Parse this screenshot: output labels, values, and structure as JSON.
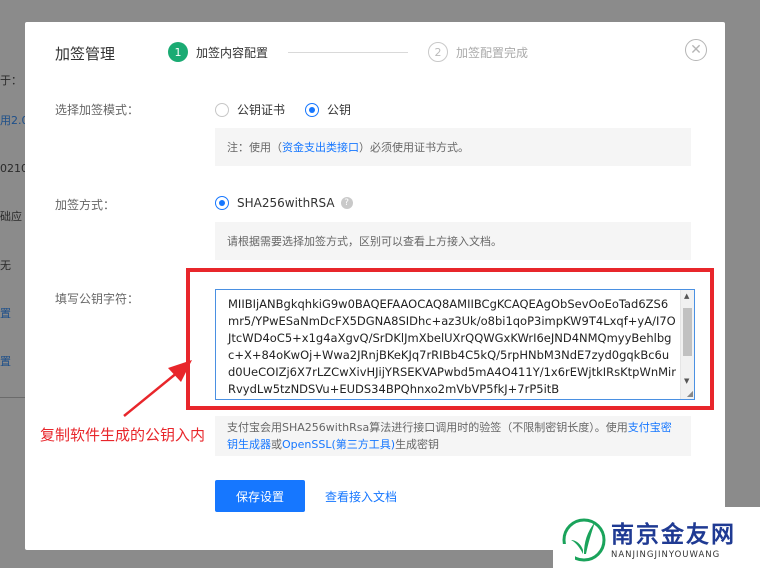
{
  "background": {
    "fragments": [
      "于：",
      "用2.0",
      "02100",
      "础应",
      "无",
      "置",
      "置"
    ]
  },
  "dialog": {
    "title": "加签管理",
    "close_glyph": "✕",
    "steps": [
      {
        "number": "1",
        "label": "加签内容配置",
        "active": true
      },
      {
        "number": "2",
        "label": "加签配置完成",
        "active": false
      }
    ],
    "mode": {
      "label": "选择加签模式：",
      "options": [
        {
          "label": "公钥证书",
          "checked": false
        },
        {
          "label": "公钥",
          "checked": true
        }
      ],
      "note_prefix": "注：使用（",
      "note_link": "资金支出类接口",
      "note_suffix": "）必须使用证书方式。"
    },
    "method": {
      "label": "加签方式：",
      "option": "SHA256withRSA",
      "help_glyph": "?",
      "note": "请根据需要选择加签方式，区别可以查看上方接入文档。"
    },
    "public_key": {
      "label": "填写公钥字符：",
      "value": "MIIBIjANBgkqhkiG9w0BAQEFAAOCAQ8AMIIBCgKCAQEAgObSevOoEoTad6ZS6mr5/YPwESaNmDcFX5DGNA8SIDhc+az3Uk/o8bi1qoP3impKW9T4Lxqf+yA/I7OJtcWD4oC5+x1g4aXgvQ/SrDKlJmXbelUXrQQWGxKWrI6eJND4NMQmyyBehlbgc+X+84oKwOj+Wwa2JRnjBKeKJq7rRIBb4C5kQ/5rpHNbM3NdE7zyd0gqkBc6ud0UeCOIZj6X7rLZCwXivHJijYRSEKVAPwbd5mA4O411Y/1x6rEWjtkIRsKtpWnMirRvydLw5tzNDSVu+EUDS34BPQhnxo2mVbVP5fkJ+7rP5itB",
      "scroll_up": "▲",
      "scroll_down": "▼",
      "resize_glyph": "◢",
      "desc_prefix": "支付宝会用SHA256withRsa算法进行接口调用时的验签（不限制密钥长度）。使用",
      "desc_link1": "支付宝密钥生成器",
      "desc_mid": "或",
      "desc_link2": "OpenSSL(第三方工具)",
      "desc_suffix": "生成密钥"
    },
    "save_button": "保存设置",
    "doc_link": "查看接入文档"
  },
  "annotation": {
    "text": "复制软件生成的公钥入内",
    "color": "#e8262b"
  },
  "watermark": {
    "cn": "南京金友网",
    "en": "NANJINGJINYOUWANG"
  },
  "colors": {
    "primary": "#1677ff",
    "step_active": "#1aab73",
    "annotation": "#e8262b"
  }
}
